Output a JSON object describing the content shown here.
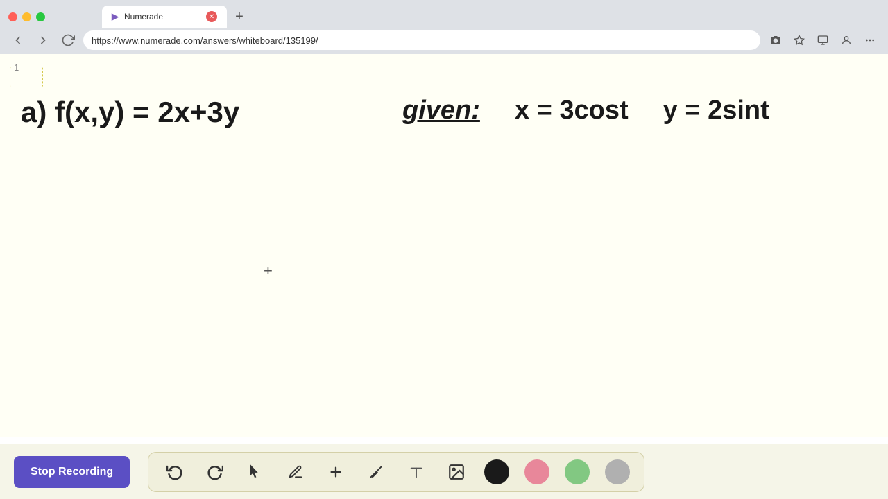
{
  "browser": {
    "tab_title": "Numerade",
    "tab_icon": "N",
    "url": "https://www.numerade.com/answers/whiteboard/135199/",
    "recording_dot_color": "#e8595a"
  },
  "nav": {
    "back_label": "←",
    "forward_label": "→",
    "refresh_label": "↻"
  },
  "whiteboard": {
    "page_number": "1",
    "equation_left": "a) f(x,y) = 2x+3y",
    "given_label": "given:",
    "equation_x": "x = 3cost",
    "equation_y": "y = 2sint"
  },
  "toolbar": {
    "stop_recording_label": "Stop Recording",
    "undo_label": "↺",
    "redo_label": "↻",
    "select_label": "▲",
    "pen_label": "✏",
    "plus_label": "+",
    "eraser_label": "/",
    "text_label": "A",
    "image_label": "🖼",
    "colors": {
      "black": "#1a1a1a",
      "pink": "#e8879a",
      "green": "#82c882",
      "gray": "#b0b0b0"
    }
  }
}
